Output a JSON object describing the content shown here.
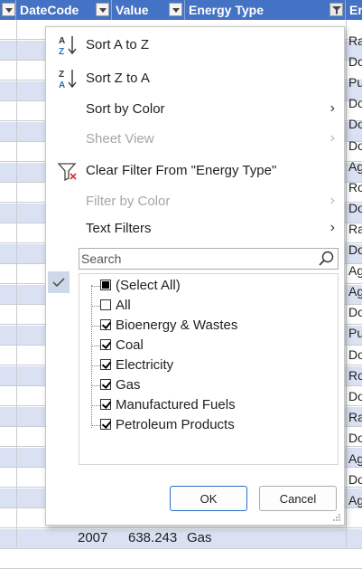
{
  "headers": [
    {
      "label": "DateCode",
      "filtered": false
    },
    {
      "label": "Value",
      "filtered": false
    },
    {
      "label": "Energy Type",
      "filtered": true
    },
    {
      "label": "Er",
      "filtered": false
    }
  ],
  "right_column_cells": [
    "Ra",
    "Do",
    "Pu",
    "Do",
    "Do",
    "Do",
    "Ag",
    "Ro",
    "Do",
    "Ra",
    "Do",
    "Ag",
    "Ag",
    "Do",
    "Pu",
    "Do",
    "Ro",
    "Do",
    "Ra",
    "Do",
    "Ag",
    "Do",
    "Ag"
  ],
  "bottom_row": {
    "datecode": "2007",
    "value": "638.243",
    "energy_type": "Gas"
  },
  "menu": {
    "sort_asc": "Sort A to Z",
    "sort_desc": "Sort Z to A",
    "sort_by_color": "Sort by Color",
    "sheet_view": "Sheet View",
    "clear_filter": "Clear Filter From \"Energy Type\"",
    "filter_by_color": "Filter by Color",
    "text_filters": "Text Filters"
  },
  "search": {
    "placeholder": "Search",
    "value": ""
  },
  "filter_items": [
    {
      "label": "(Select All)",
      "state": "partial"
    },
    {
      "label": "All",
      "state": "unchecked"
    },
    {
      "label": "Bioenergy & Wastes",
      "state": "checked"
    },
    {
      "label": "Coal",
      "state": "checked"
    },
    {
      "label": "Electricity",
      "state": "checked"
    },
    {
      "label": "Gas",
      "state": "checked"
    },
    {
      "label": "Manufactured Fuels",
      "state": "checked"
    },
    {
      "label": "Petroleum Products",
      "state": "checked"
    }
  ],
  "buttons": {
    "ok": "OK",
    "cancel": "Cancel"
  },
  "colors": {
    "header_bg": "#4472c4",
    "band_bg": "#d9e1f2",
    "accent": "#2b6fc4"
  }
}
